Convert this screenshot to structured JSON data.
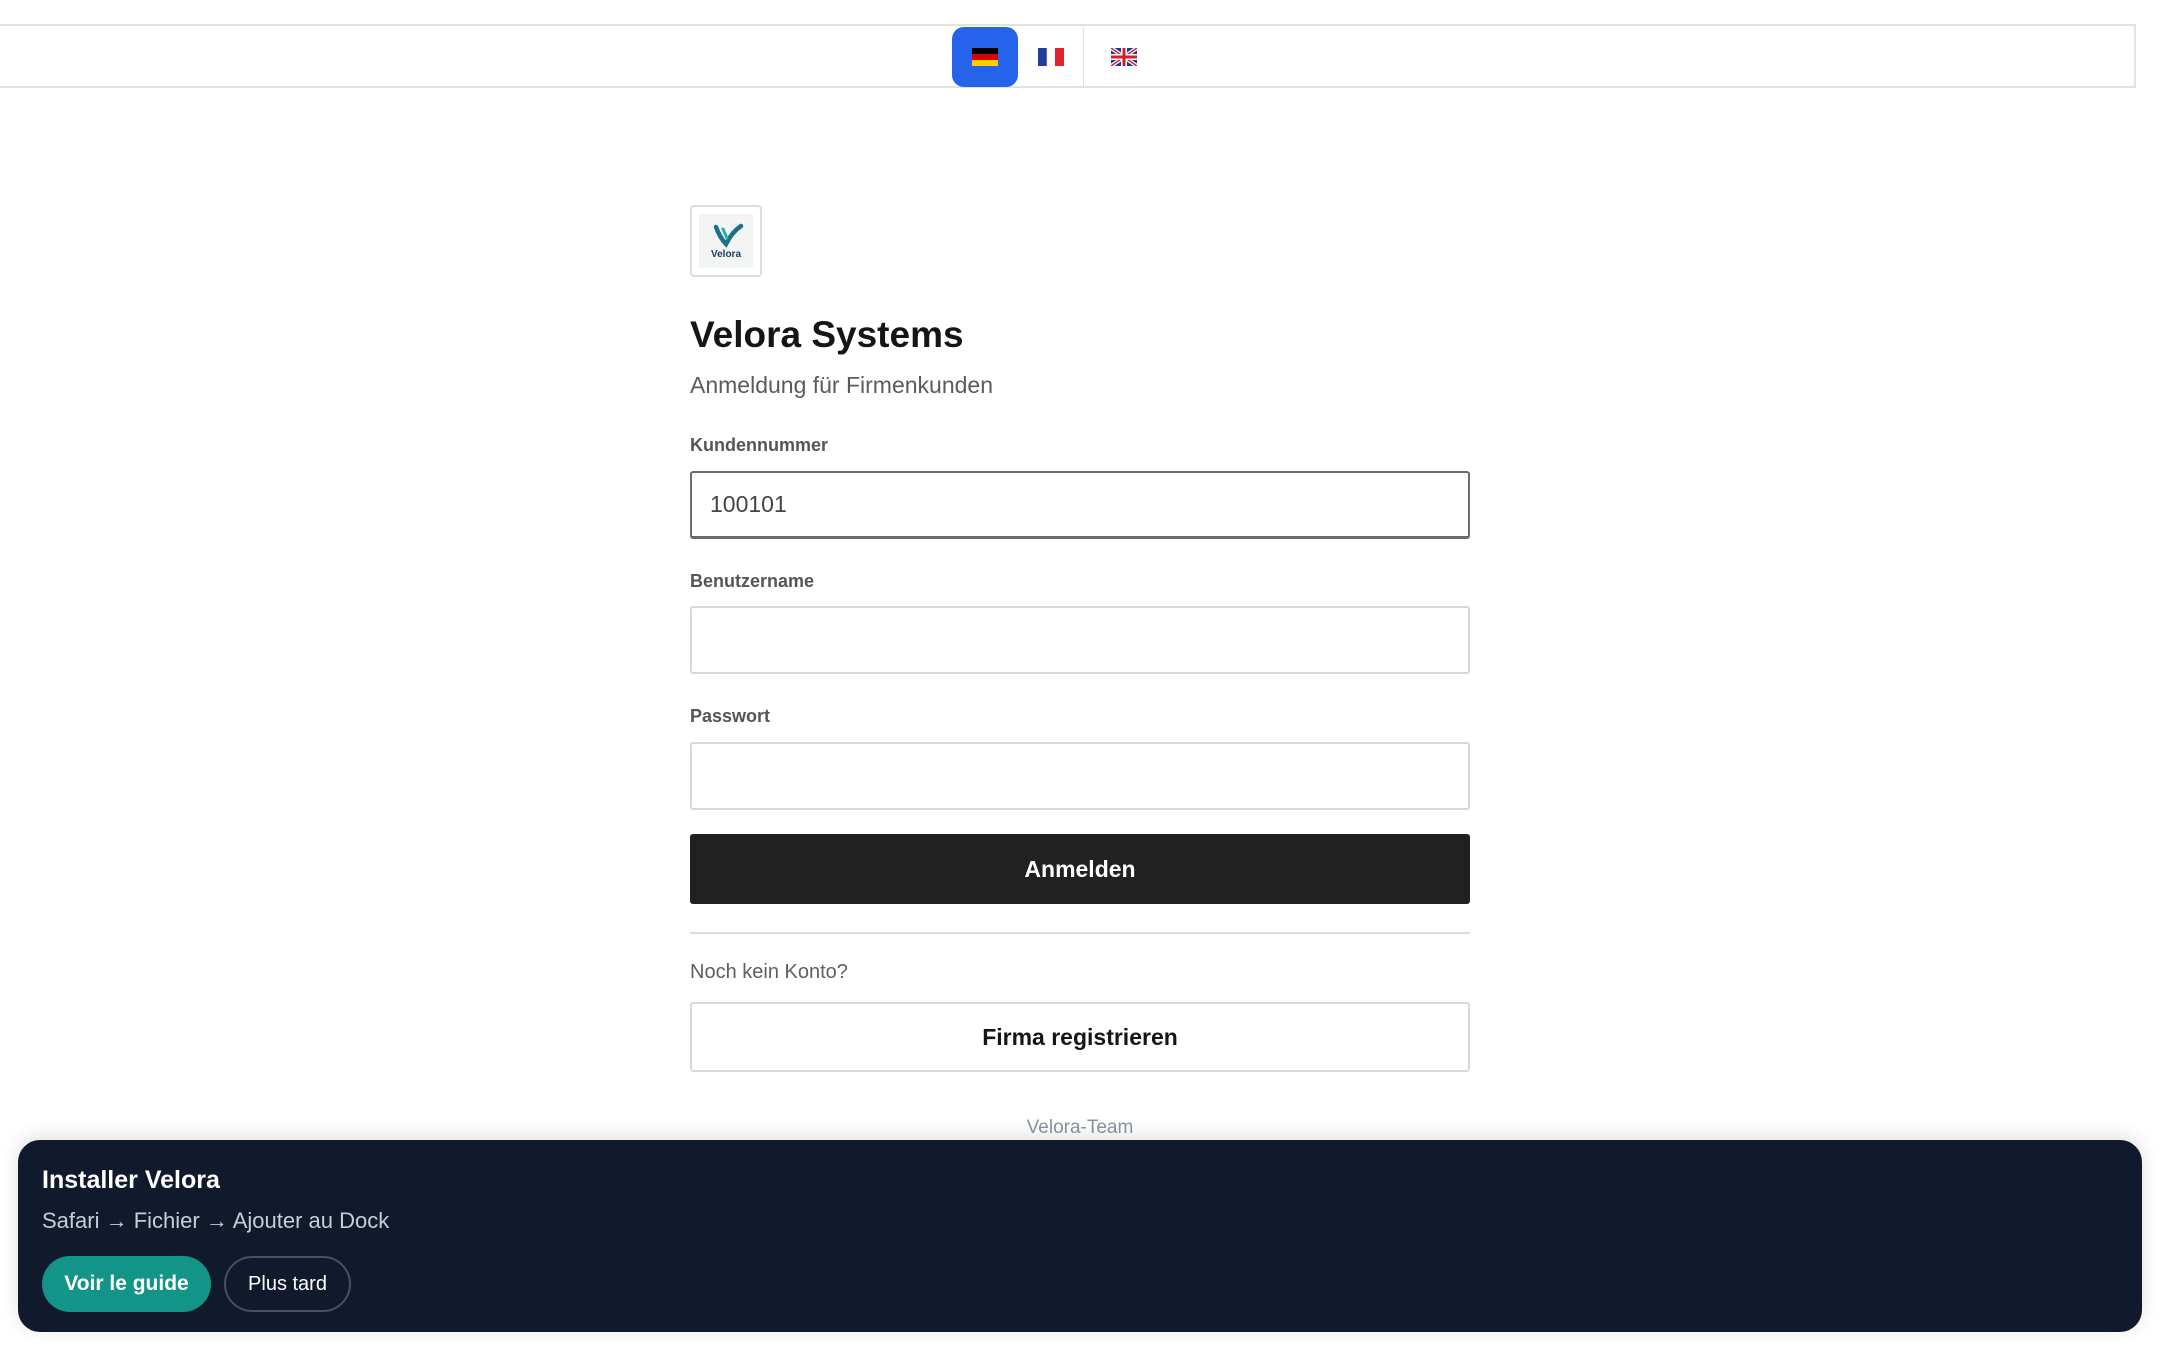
{
  "languages": [
    {
      "code": "de",
      "icon": "flag-germany-icon",
      "active": true
    },
    {
      "code": "fr",
      "icon": "flag-france-icon",
      "active": false
    },
    {
      "code": "gb",
      "icon": "flag-uk-icon",
      "active": false
    }
  ],
  "colors": {
    "accent_blue": "#2563eb",
    "primary_button": "#212121",
    "banner_bg": "#111a2c",
    "guide_button": "#129488"
  },
  "login": {
    "logo_text": "Velora",
    "title": "Velora Systems",
    "subtitle": "Anmeldung für Firmenkunden",
    "customer_number_label": "Kundennummer",
    "customer_number_value": "100101",
    "username_label": "Benutzername",
    "username_value": "",
    "password_label": "Passwort",
    "password_value": "",
    "submit_label": "Anmelden",
    "no_account_text": "Noch kein Konto?",
    "register_label": "Firma registrieren",
    "team_text": "Velora-Team"
  },
  "install_banner": {
    "title": "Installer Velora",
    "instructions": "Safari → Fichier → Ajouter au Dock",
    "guide_label": "Voir le guide",
    "later_label": "Plus tard"
  }
}
